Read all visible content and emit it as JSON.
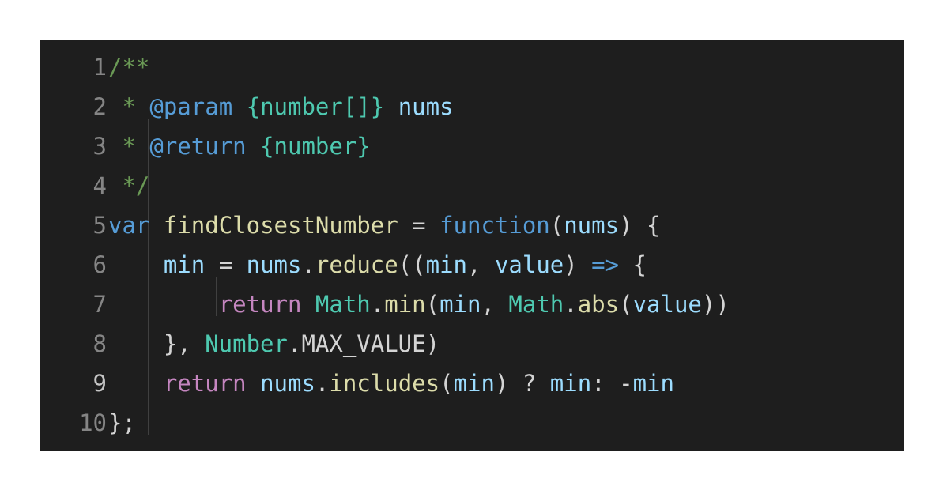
{
  "colors": {
    "background": "#1e1e1e",
    "line_number": "#858585",
    "line_number_active": "#c6c6c6",
    "comment": "#6a9955",
    "doc_tag": "#569cd6",
    "doc_type": "#4ec9b0",
    "doc_param": "#9cdcfe",
    "keyword": "#569cd6",
    "control": "#c586c0",
    "function": "#dcdcaa",
    "variable": "#9cdcfe",
    "class": "#4ec9b0",
    "plain": "#d4d4d4"
  },
  "active_line": 9,
  "lines": [
    {
      "number": "1",
      "tokens": [
        {
          "text": "/**",
          "kind": "comment"
        }
      ]
    },
    {
      "number": "2",
      "tokens": [
        {
          "text": " * ",
          "kind": "comment"
        },
        {
          "text": "@param",
          "kind": "doc_tag"
        },
        {
          "text": " ",
          "kind": "comment"
        },
        {
          "text": "{number[]}",
          "kind": "doc_type"
        },
        {
          "text": " ",
          "kind": "comment"
        },
        {
          "text": "nums",
          "kind": "doc_param"
        }
      ]
    },
    {
      "number": "3",
      "tokens": [
        {
          "text": " * ",
          "kind": "comment"
        },
        {
          "text": "@return",
          "kind": "doc_tag"
        },
        {
          "text": " ",
          "kind": "comment"
        },
        {
          "text": "{number}",
          "kind": "doc_type"
        }
      ]
    },
    {
      "number": "4",
      "tokens": [
        {
          "text": " */",
          "kind": "comment"
        }
      ]
    },
    {
      "number": "5",
      "tokens": [
        {
          "text": "var",
          "kind": "keyword"
        },
        {
          "text": " ",
          "kind": "plain"
        },
        {
          "text": "findClosestNumber",
          "kind": "function"
        },
        {
          "text": " = ",
          "kind": "plain"
        },
        {
          "text": "function",
          "kind": "keyword"
        },
        {
          "text": "(",
          "kind": "plain"
        },
        {
          "text": "nums",
          "kind": "variable"
        },
        {
          "text": ") {",
          "kind": "plain"
        }
      ]
    },
    {
      "number": "6",
      "tokens": [
        {
          "text": "    ",
          "kind": "plain"
        },
        {
          "text": "min",
          "kind": "variable"
        },
        {
          "text": " = ",
          "kind": "plain"
        },
        {
          "text": "nums",
          "kind": "variable"
        },
        {
          "text": ".",
          "kind": "plain"
        },
        {
          "text": "reduce",
          "kind": "function"
        },
        {
          "text": "((",
          "kind": "plain"
        },
        {
          "text": "min",
          "kind": "variable"
        },
        {
          "text": ", ",
          "kind": "plain"
        },
        {
          "text": "value",
          "kind": "variable"
        },
        {
          "text": ") ",
          "kind": "plain"
        },
        {
          "text": "=>",
          "kind": "keyword"
        },
        {
          "text": " {",
          "kind": "plain"
        }
      ]
    },
    {
      "number": "7",
      "tokens": [
        {
          "text": "        ",
          "kind": "plain"
        },
        {
          "text": "return",
          "kind": "control"
        },
        {
          "text": " ",
          "kind": "plain"
        },
        {
          "text": "Math",
          "kind": "class"
        },
        {
          "text": ".",
          "kind": "plain"
        },
        {
          "text": "min",
          "kind": "function"
        },
        {
          "text": "(",
          "kind": "plain"
        },
        {
          "text": "min",
          "kind": "variable"
        },
        {
          "text": ", ",
          "kind": "plain"
        },
        {
          "text": "Math",
          "kind": "class"
        },
        {
          "text": ".",
          "kind": "plain"
        },
        {
          "text": "abs",
          "kind": "function"
        },
        {
          "text": "(",
          "kind": "plain"
        },
        {
          "text": "value",
          "kind": "variable"
        },
        {
          "text": "))",
          "kind": "plain"
        }
      ]
    },
    {
      "number": "8",
      "tokens": [
        {
          "text": "    }, ",
          "kind": "plain"
        },
        {
          "text": "Number",
          "kind": "class"
        },
        {
          "text": ".MAX_VALUE)",
          "kind": "plain"
        }
      ]
    },
    {
      "number": "9",
      "tokens": [
        {
          "text": "    ",
          "kind": "plain"
        },
        {
          "text": "return",
          "kind": "control"
        },
        {
          "text": " ",
          "kind": "plain"
        },
        {
          "text": "nums",
          "kind": "variable"
        },
        {
          "text": ".",
          "kind": "plain"
        },
        {
          "text": "includes",
          "kind": "function"
        },
        {
          "text": "(",
          "kind": "plain"
        },
        {
          "text": "min",
          "kind": "variable"
        },
        {
          "text": ") ? ",
          "kind": "plain"
        },
        {
          "text": "min",
          "kind": "variable"
        },
        {
          "text": ": -",
          "kind": "plain"
        },
        {
          "text": "min",
          "kind": "variable"
        }
      ]
    },
    {
      "number": "10",
      "tokens": [
        {
          "text": "};",
          "kind": "plain"
        }
      ]
    }
  ]
}
